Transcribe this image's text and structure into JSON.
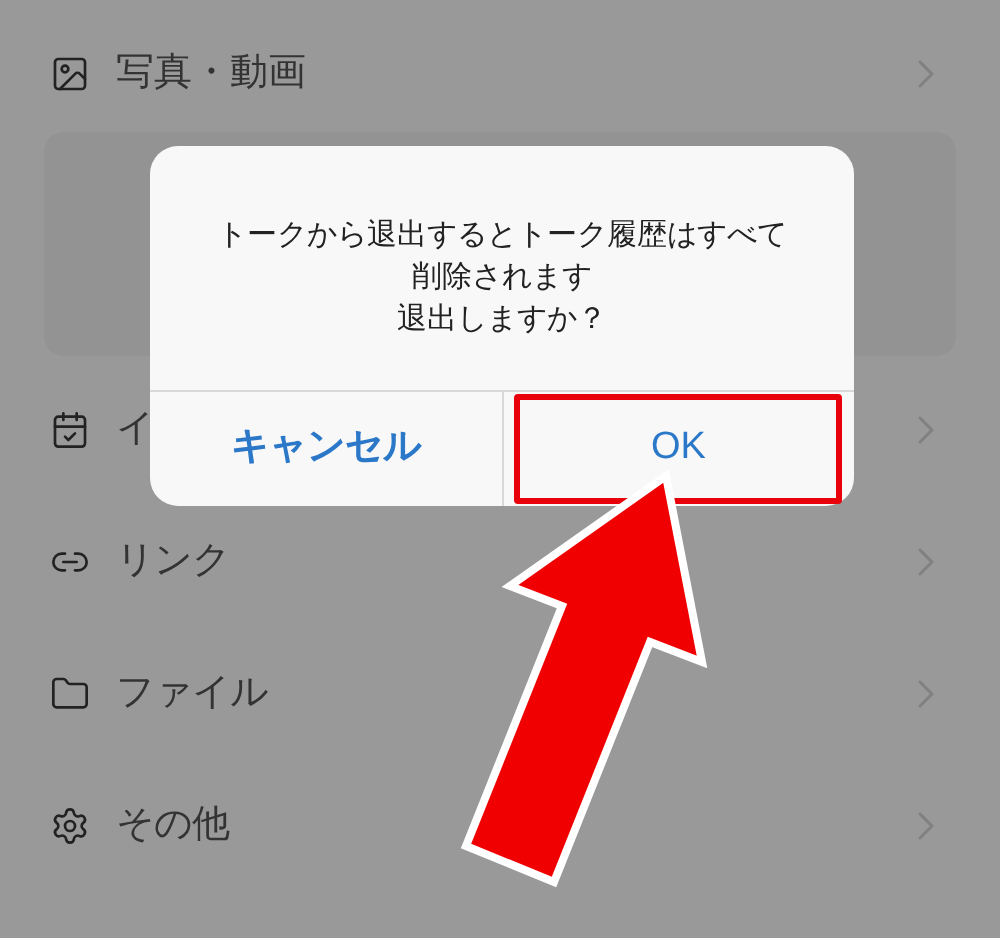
{
  "menu_items": [
    {
      "kind": "photo",
      "label": "写真・動画"
    },
    {
      "kind": "panel"
    },
    {
      "kind": "event",
      "label": "イ"
    },
    {
      "kind": "link",
      "label": "リンク"
    },
    {
      "kind": "file",
      "label": "ファイル"
    },
    {
      "kind": "other",
      "label": "その他"
    }
  ],
  "dialog": {
    "message_lines": [
      "トークから退出するとトーク履歴はすべて",
      "削除されます",
      "退出しますか？"
    ],
    "buttons": [
      {
        "label": "キャンセル",
        "highlighted": false
      },
      {
        "label": "OK",
        "highlighted": true
      }
    ]
  }
}
